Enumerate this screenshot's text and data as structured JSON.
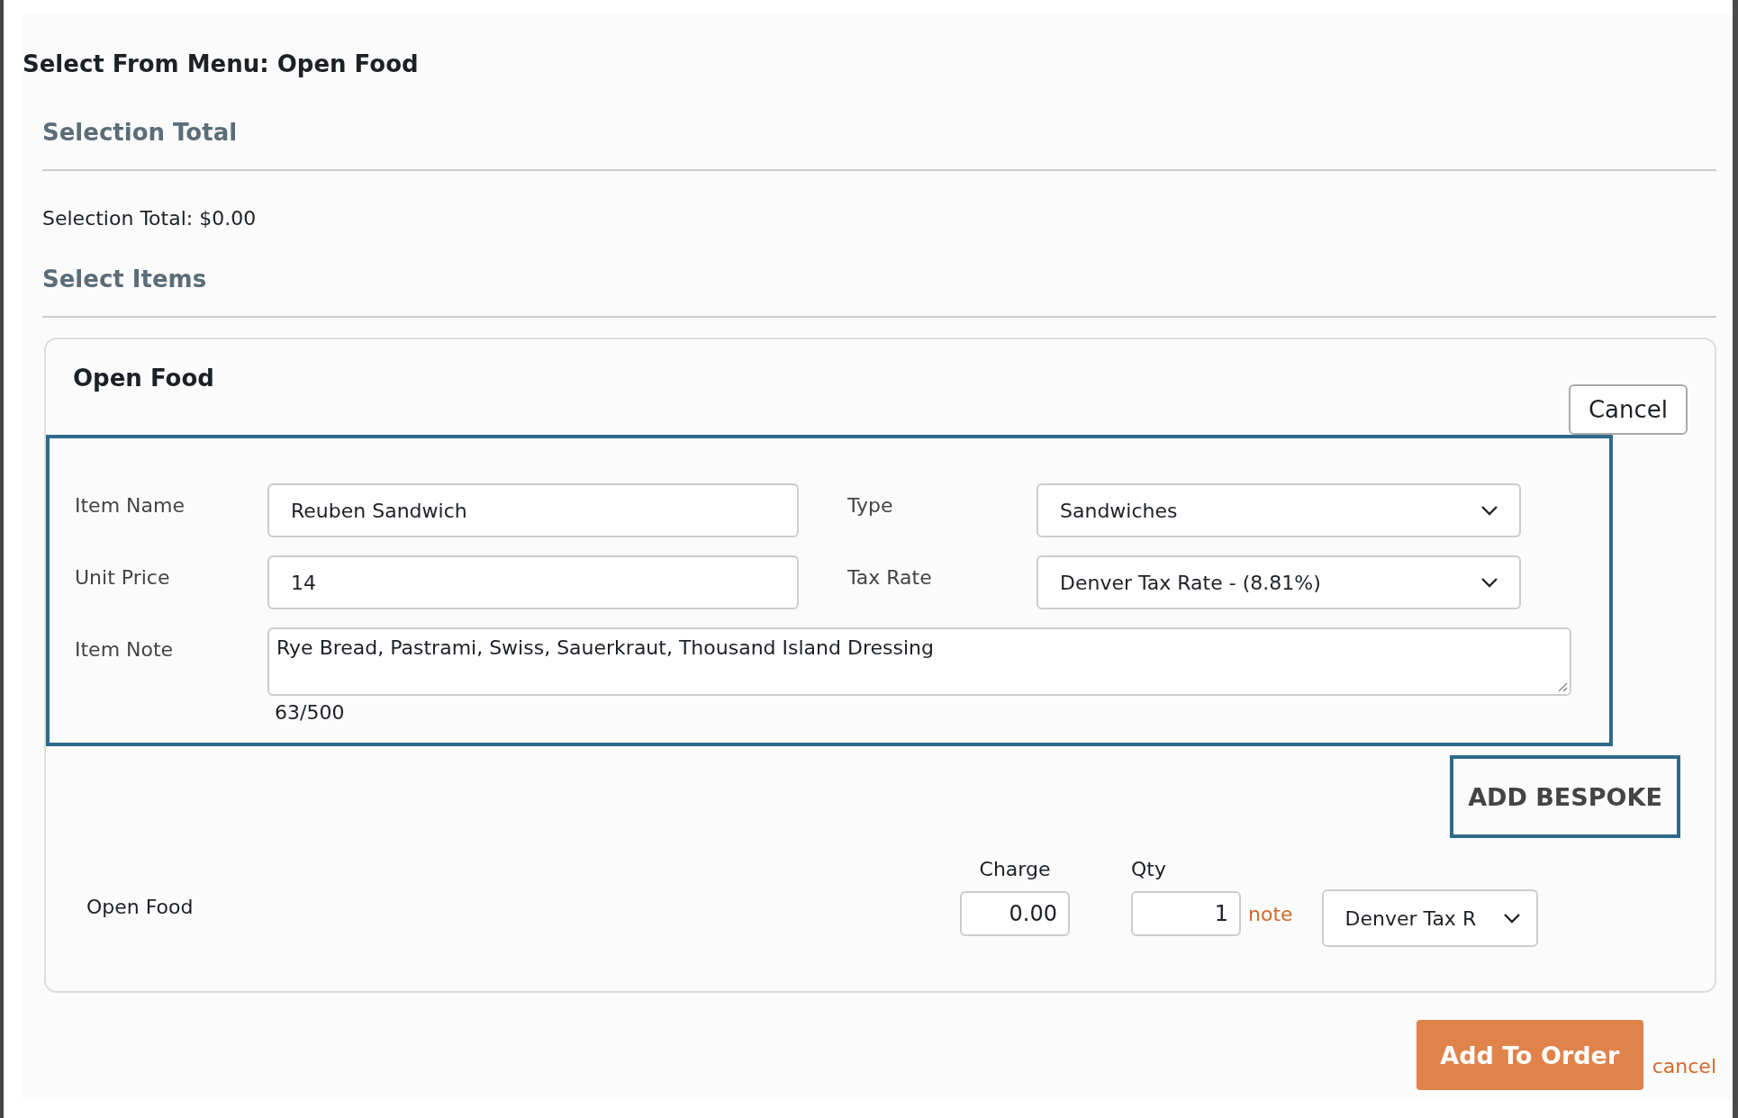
{
  "dialog": {
    "title": "Select From Menu: Open Food"
  },
  "selection_total": {
    "heading": "Selection Total",
    "text": "Selection Total: $0.00"
  },
  "select_items": {
    "heading": "Select Items"
  },
  "card": {
    "title": "Open Food",
    "cancel_button": "Cancel",
    "form": {
      "fields": [
        {
          "kind": "text",
          "label": "Item Name",
          "value": "Reuben Sandwich"
        },
        {
          "kind": "select",
          "label": "Type",
          "value": "Sandwiches"
        },
        {
          "kind": "text",
          "label": "Unit Price",
          "value": "14"
        },
        {
          "kind": "select",
          "label": "Tax Rate",
          "value": "Denver Tax Rate - (8.81%)"
        }
      ],
      "note": {
        "label": "Item Note",
        "value": "Rye Bread, Pastrami, Swiss, Sauerkraut, Thousand Island Dressing",
        "counter": "63/500"
      }
    },
    "add_bespoke_button": "ADD BESPOKE",
    "line": {
      "name": "Open Food",
      "charge_label": "Charge",
      "charge": "0.00",
      "qty_label": "Qty",
      "qty": "1",
      "note_link": "note",
      "tax": "Denver Tax R"
    }
  },
  "footer": {
    "add_button": "Add To Order",
    "cancel_link": "cancel"
  }
}
